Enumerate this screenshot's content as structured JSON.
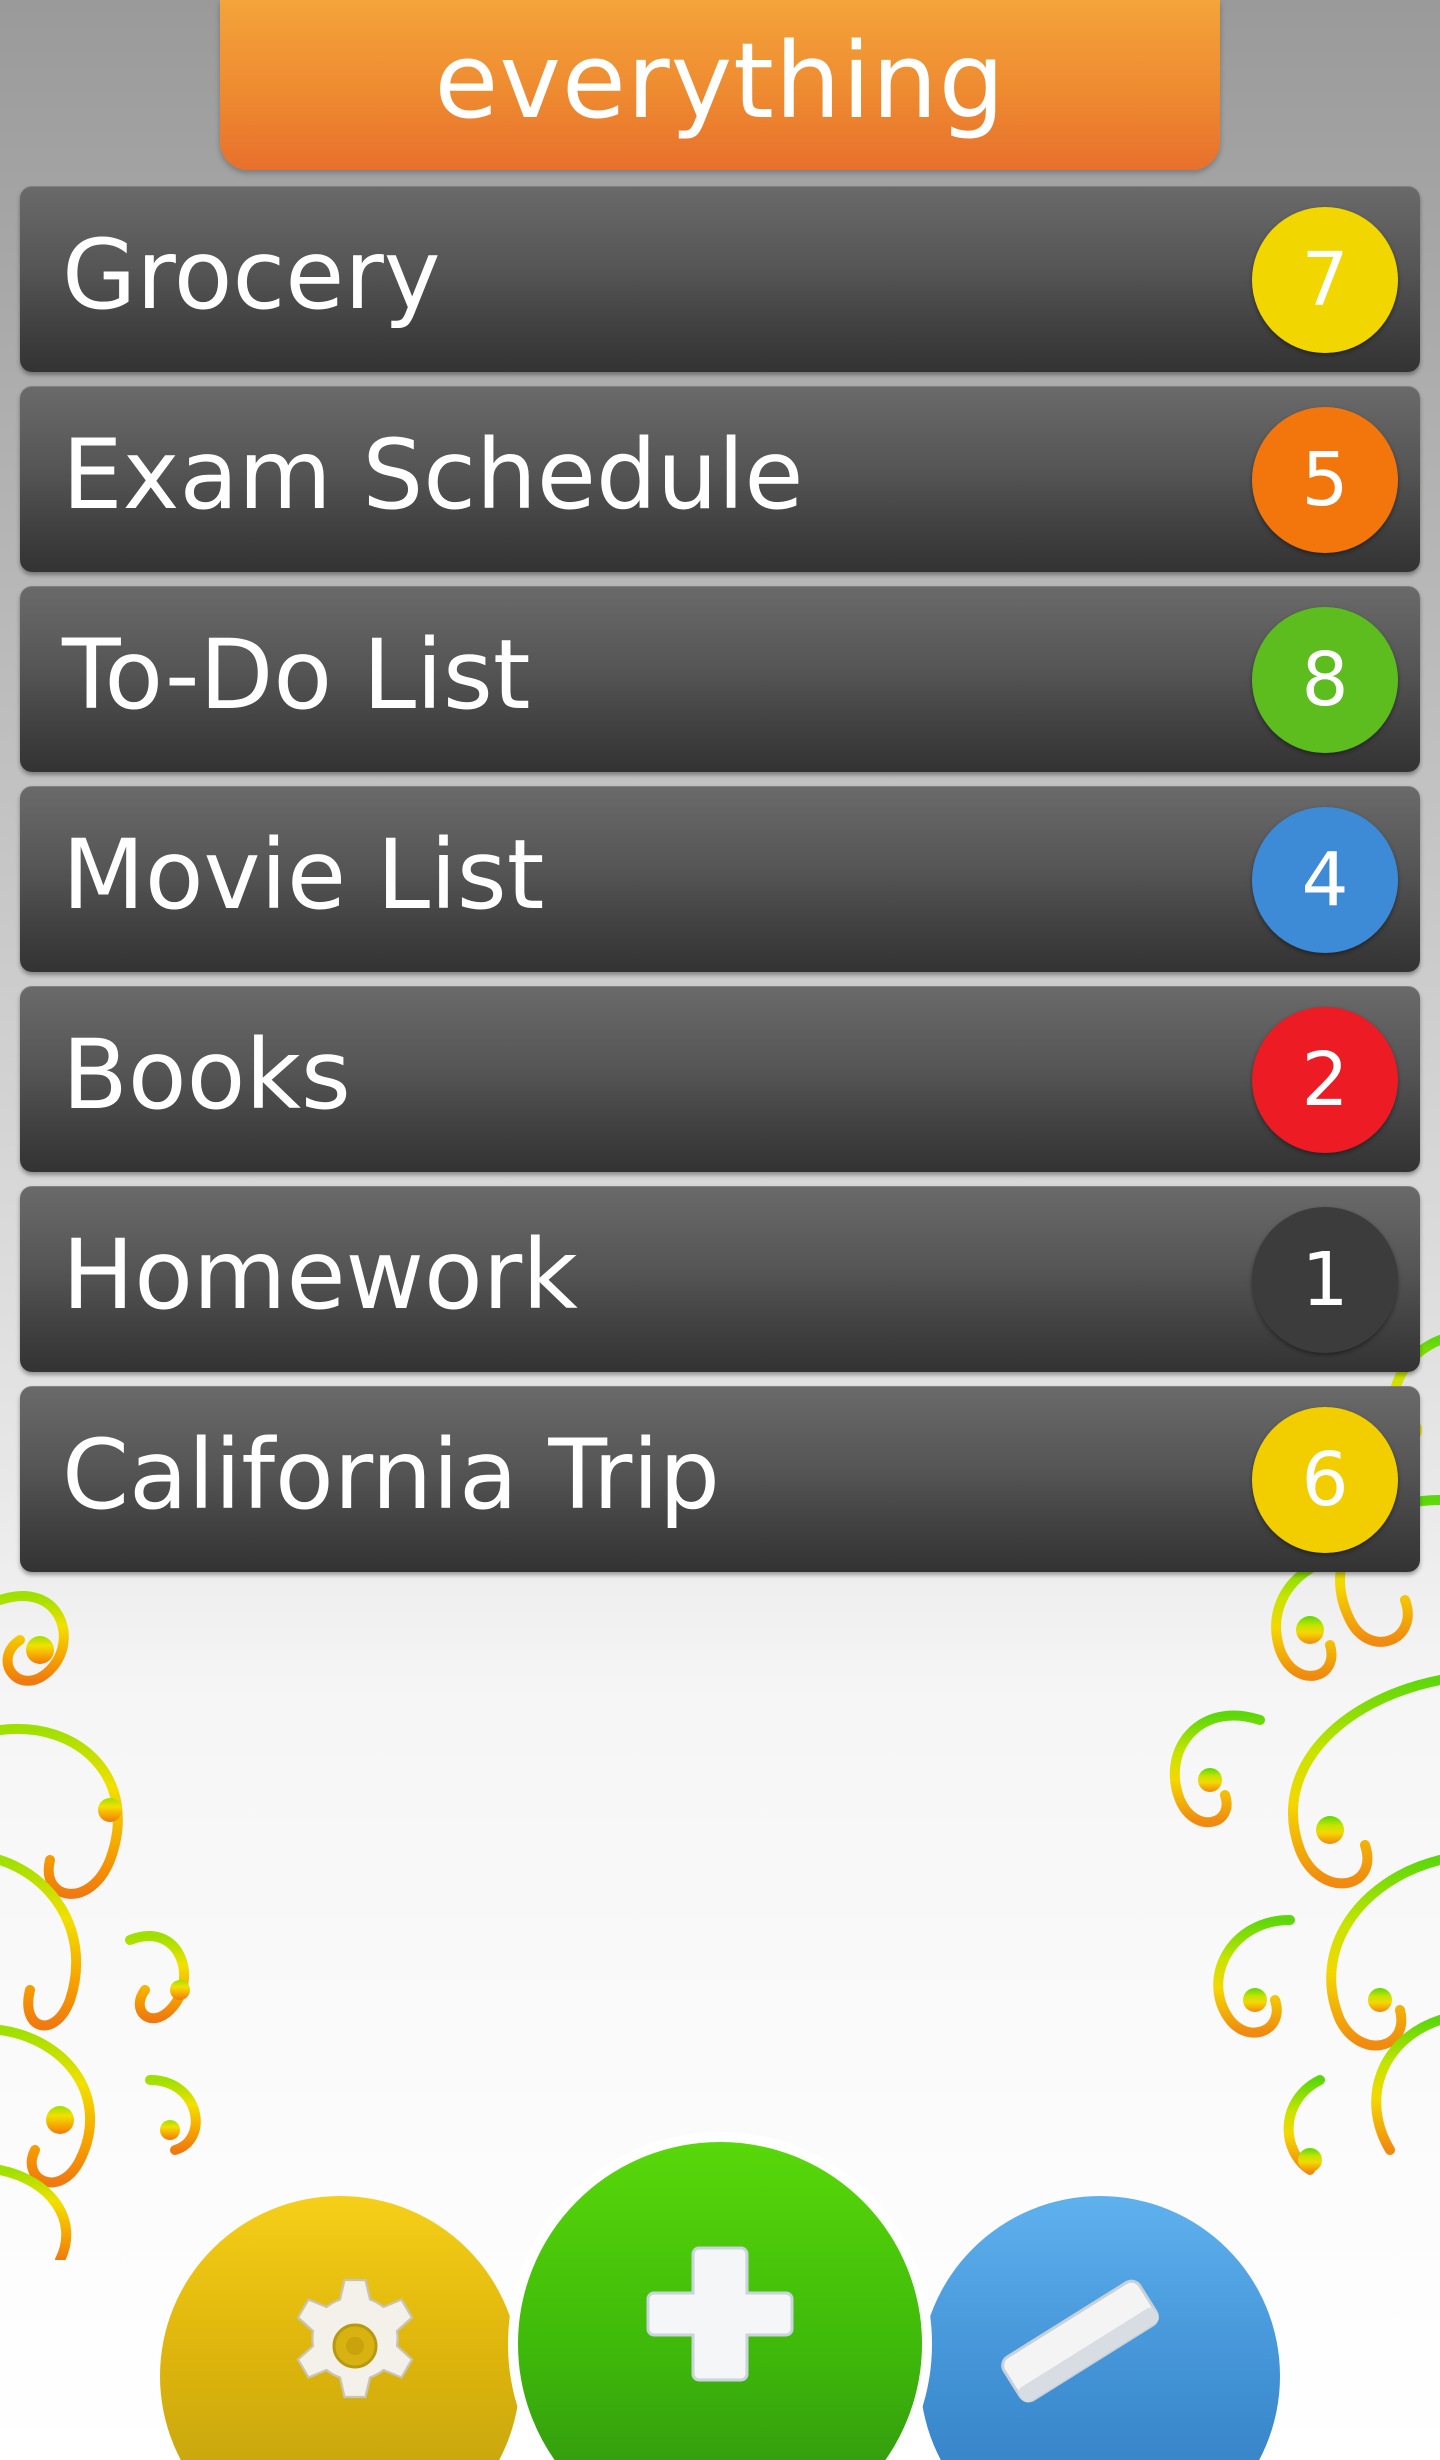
{
  "header": {
    "title": "everything"
  },
  "lists": [
    {
      "label": "Grocery",
      "count": "7",
      "color": "#f2d600"
    },
    {
      "label": "Exam Schedule",
      "count": "5",
      "color": "#f3760d"
    },
    {
      "label": "To-Do List",
      "count": "8",
      "color": "#5ebd1e"
    },
    {
      "label": "Movie List",
      "count": "4",
      "color": "#3d8ad7"
    },
    {
      "label": "Books",
      "count": "2",
      "color": "#ec1b24"
    },
    {
      "label": "Homework",
      "count": "1",
      "color": "#3c3c3c"
    },
    {
      "label": "California Trip",
      "count": "6",
      "color": "#f2ce00"
    }
  ],
  "toolbar": {
    "settings_icon": "gear-icon",
    "add_icon": "plus-icon",
    "edit_icon": "eraser-icon",
    "colors": {
      "settings": "#e0b80e",
      "add": "#44c00a",
      "edit": "#4393d6"
    }
  },
  "theme": {
    "header_color": "#ee8a30",
    "item_color": "#4a4a4a"
  }
}
